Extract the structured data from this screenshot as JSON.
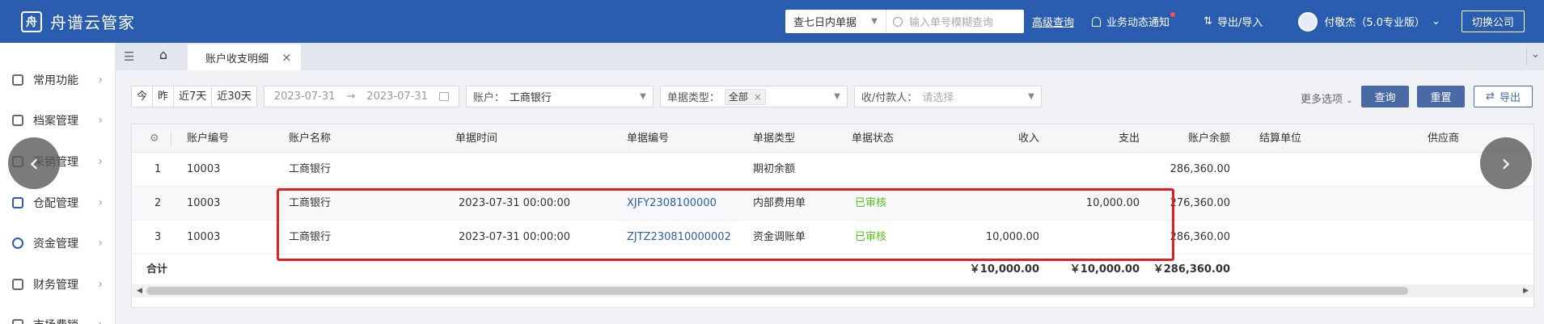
{
  "app": {
    "title": "舟谱云管家",
    "logo_glyph": "舟"
  },
  "topbar": {
    "range_select": "查七日内单据",
    "search_placeholder": "输入单号模糊查询",
    "advanced_search": "高级查询",
    "notifications": "业务动态通知",
    "import_export": "导出/导入",
    "user": "付敬杰（5.0专业版）",
    "switch_company": "切换公司"
  },
  "sidebar": {
    "items": [
      {
        "label": "常用功能"
      },
      {
        "label": "档案管理"
      },
      {
        "label": "采销管理"
      },
      {
        "label": "仓配管理"
      },
      {
        "label": "资金管理"
      },
      {
        "label": "财务管理"
      },
      {
        "label": "市场费销"
      }
    ]
  },
  "tabs": {
    "active": "账户收支明细"
  },
  "filters": {
    "quick": [
      "今",
      "昨",
      "近7天",
      "近30天"
    ],
    "date_start": "2023-07-31",
    "date_end": "2023-07-31",
    "account_label": "账户：",
    "account_value": "工商银行",
    "doc_type_label": "单据类型：",
    "doc_type_value": "全部",
    "payee_label": "收/付款人：",
    "payee_placeholder": "请选择",
    "more_options": "更多选项",
    "query": "查询",
    "reset": "重置",
    "export": "导出"
  },
  "table": {
    "headers": [
      "账户编号",
      "账户名称",
      "单据时间",
      "单据编号",
      "单据类型",
      "单据状态",
      "收入",
      "支出",
      "账户余额",
      "结算单位",
      "供应商"
    ],
    "rows": [
      {
        "no": "1",
        "acct_no": "10003",
        "acct_name": "工商银行",
        "time": "",
        "doc_no": "",
        "doc_type": "期初余额",
        "status": "",
        "income": "",
        "expense": "",
        "balance": "286,360.00"
      },
      {
        "no": "2",
        "acct_no": "10003",
        "acct_name": "工商银行",
        "time": "2023-07-31 00:00:00",
        "doc_no": "XJFY2308100000",
        "doc_type": "内部费用单",
        "status": "已审核",
        "income": "",
        "expense": "10,000.00",
        "balance": "276,360.00"
      },
      {
        "no": "3",
        "acct_no": "10003",
        "acct_name": "工商银行",
        "time": "2023-07-31 00:00:00",
        "doc_no": "ZJTZ230810000002",
        "doc_type": "资金调账单",
        "status": "已审核",
        "income": "10,000.00",
        "expense": "",
        "balance": "286,360.00"
      }
    ],
    "total_label": "合计",
    "total_income": "￥10,000.00",
    "total_expense": "￥10,000.00",
    "total_balance": "￥286,360.00"
  },
  "colors": {
    "brand": "#2a5db0",
    "approved": "#52c41a",
    "highlight": "#e02020"
  }
}
